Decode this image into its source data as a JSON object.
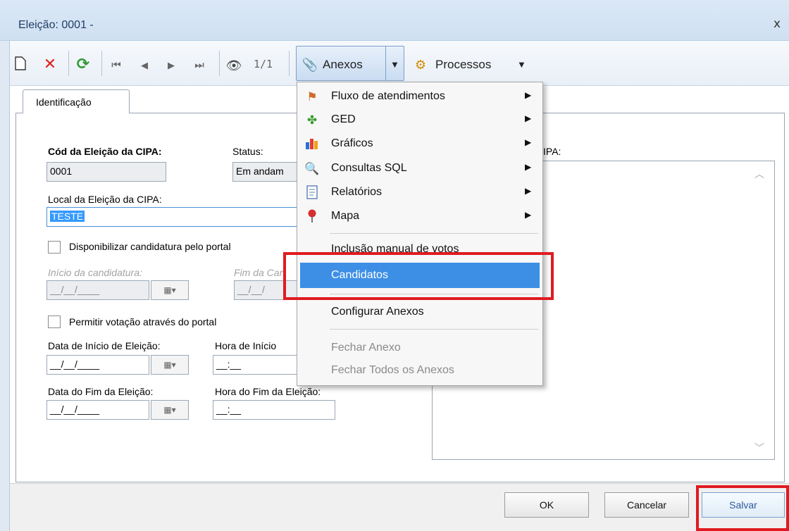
{
  "window": {
    "title": "Eleição: 0001 -",
    "close": "x"
  },
  "toolbar": {
    "record_counter": "1/1",
    "anexos_label": "Anexos",
    "processos_label": "Processos"
  },
  "tabs": [
    {
      "label": "Identificação"
    }
  ],
  "form": {
    "cod_label": "Cód da Eleição da CIPA:",
    "cod_value": "0001",
    "status_label": "Status:",
    "status_value": "Em andam",
    "local_label": "Local da Eleição da CIPA:",
    "local_value": "TESTE",
    "right_label_fragment": "IPA:",
    "disponibilizar_label": "Disponibilizar candidatura pelo portal",
    "inicio_candidatura_label": "Início da candidatura:",
    "inicio_candidatura_value": "__/__/____",
    "fim_candidatura_label": "Fim da Can",
    "fim_candidatura_value": "__/__/",
    "permitir_label": "Permitir votação através do portal",
    "data_inicio_label": "Data de Início de Eleição:",
    "data_inicio_value": "__/__/____",
    "hora_inicio_label": "Hora de Início",
    "hora_inicio_value": "__:__",
    "data_fim_label": "Data do Fim da Eleição:",
    "data_fim_value": "__/__/____",
    "hora_fim_label": "Hora do Fim da Eleição:",
    "hora_fim_value": "__:__"
  },
  "menu": {
    "items": [
      {
        "label": "Fluxo de atendimentos",
        "icon": "flow-icon",
        "submenu": true
      },
      {
        "label": "GED",
        "icon": "ged-icon",
        "submenu": true
      },
      {
        "label": "Gráficos",
        "icon": "chart-icon",
        "submenu": true
      },
      {
        "label": "Consultas SQL",
        "icon": "sql-query-icon",
        "submenu": true
      },
      {
        "label": "Relatórios",
        "icon": "report-icon",
        "submenu": true
      },
      {
        "label": "Mapa",
        "icon": "map-pin-icon",
        "submenu": true
      },
      {
        "label": "Inclusão manual de votos",
        "icon": "",
        "submenu": false
      },
      {
        "label": "Candidatos",
        "icon": "",
        "submenu": false
      },
      {
        "label": "Configurar Anexos",
        "icon": "",
        "submenu": false
      },
      {
        "label": "Fechar Anexo",
        "icon": "",
        "submenu": false
      },
      {
        "label": "Fechar Todos os Anexos",
        "icon": "",
        "submenu": false
      }
    ]
  },
  "buttons": {
    "ok": "OK",
    "cancelar": "Cancelar",
    "salvar": "Salvar"
  },
  "colors": {
    "highlight": "#e01b22",
    "menu_selected": "#3d8fe6",
    "title_text": "#1f3d66"
  }
}
